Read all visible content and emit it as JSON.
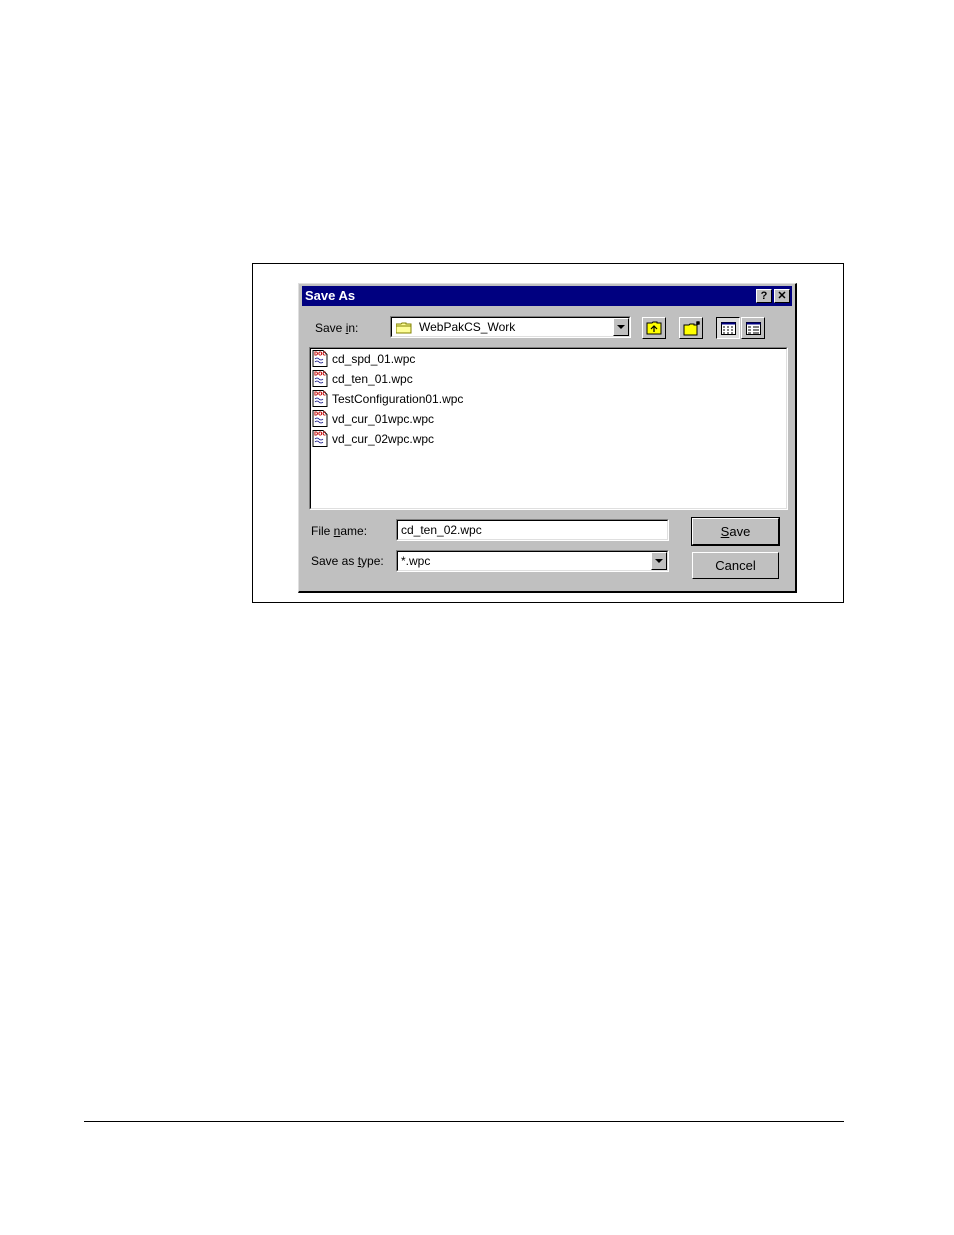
{
  "dialog": {
    "title": "Save As",
    "help_button": "?",
    "close_button": "✕",
    "save_in_label_pre": "Save ",
    "save_in_label_accel": "i",
    "save_in_label_post": "n:",
    "save_in_value": "WebPakCS_Work",
    "files": [
      {
        "name": "cd_spd_01.wpc"
      },
      {
        "name": "cd_ten_01.wpc"
      },
      {
        "name": "TestConfiguration01.wpc"
      },
      {
        "name": "vd_cur_01wpc.wpc"
      },
      {
        "name": "vd_cur_02wpc.wpc"
      }
    ],
    "file_name_label_pre": "File ",
    "file_name_label_accel": "n",
    "file_name_label_post": "ame:",
    "file_name_value": "cd_ten_02.wpc",
    "save_type_label_pre": "Save as ",
    "save_type_label_accel": "t",
    "save_type_label_post": "ype:",
    "save_type_value": "*.wpc",
    "save_button_accel": "S",
    "save_button_rest": "ave",
    "cancel_button": "Cancel"
  }
}
